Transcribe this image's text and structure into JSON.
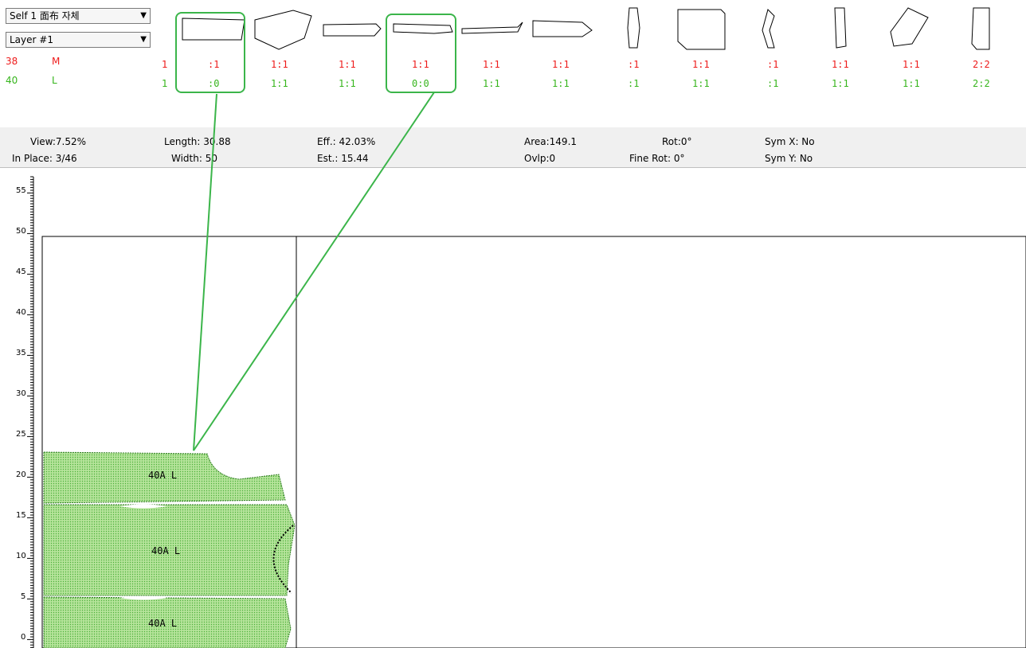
{
  "fabric_selector": {
    "value": "Self 1 面布 자체"
  },
  "layer_selector": {
    "value": "Layer #1"
  },
  "size_rows": [
    {
      "size": "38",
      "code": "M",
      "first": "1",
      "color": "#ee1b1b",
      "counts": [
        ":1",
        "1:1",
        "1:1",
        "1:1",
        "1:1",
        "1:1",
        ":1",
        "1:1",
        ":1",
        "1:1",
        "1:1",
        "2:2"
      ]
    },
    {
      "size": "40",
      "code": "L",
      "first": "1",
      "color": "#36b51c",
      "counts": [
        ":0",
        "1:1",
        "1:1",
        "0:0",
        "1:1",
        "1:1",
        ":1",
        "1:1",
        ":1",
        "1:1",
        "1:1",
        "2:2"
      ]
    }
  ],
  "status": {
    "view": "View:7.52%",
    "in_place": "In Place: 3/46",
    "length": "Length: 30.88",
    "width": "Width: 50",
    "eff": "Eff.: 42.03%",
    "est": "Est.: 15.44",
    "area": "Area:149.1",
    "ovlp": "Ovlp:0",
    "rot": "Rot:0°",
    "fine_rot": "Fine Rot: 0°",
    "sym_x": "Sym X: No",
    "sym_y": "Sym Y: No"
  },
  "ruler_labels": [
    "55",
    "50",
    "45",
    "40",
    "35",
    "30",
    "25",
    "20",
    "15",
    "10",
    "5",
    "0"
  ],
  "pieces": [
    "40A L",
    "40A L",
    "40A L"
  ],
  "colors": {
    "highlight": "#3bb54a",
    "piece_fill": "#a6dc8a",
    "size1": "#ee1b1b",
    "size2": "#36b51c"
  }
}
